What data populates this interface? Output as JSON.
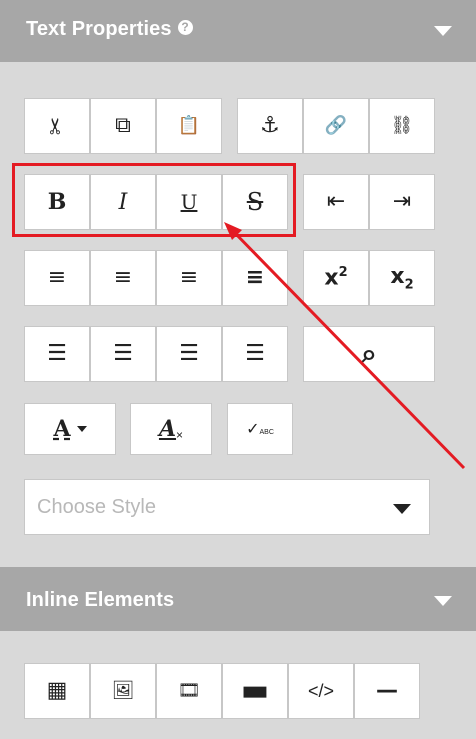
{
  "text_properties": {
    "title": "Text Properties",
    "help_glyph": "?",
    "collapse_icon": "caret-down-icon"
  },
  "toolbar": {
    "cut_icon": "✂",
    "copy_icon": "⧉",
    "paste_icon": "📋",
    "anchor_icon": "⚓",
    "link_icon": "🔗",
    "unlink_icon": "⛓",
    "bold_label": "B",
    "italic_label": "I",
    "underline_label": "U",
    "strike_label": "S",
    "outdent_icon": "⇤",
    "indent_icon": "⇥",
    "align_left_icon": "≡",
    "align_center_icon": "≡",
    "align_right_icon": "≡",
    "justify_icon": "≡",
    "superscript_base": "x",
    "superscript_exp": "2",
    "subscript_base": "x",
    "subscript_idx": "2",
    "bullet_list_icon": "☰",
    "numbered_list_icon": "☰",
    "alpha_list_icon": "☰",
    "roman_list_icon": "☰",
    "search_icon": "⌕",
    "font_color_label": "A",
    "clear_format_label": "A",
    "clear_format_x": "×",
    "spellcheck_label": "✓",
    "spellcheck_sub": "ABC"
  },
  "style_select": {
    "placeholder": "Choose Style"
  },
  "inline_elements": {
    "title": "Inline Elements",
    "table_icon": "▦",
    "image_icon": "🖼",
    "video_icon": "🎞",
    "button_icon": "▬",
    "code_label": "</>",
    "hr_label": "—"
  },
  "colors": {
    "header_bg": "#a7a7a7",
    "panel_bg": "#d9d9d9",
    "highlight": "#e41b23"
  }
}
